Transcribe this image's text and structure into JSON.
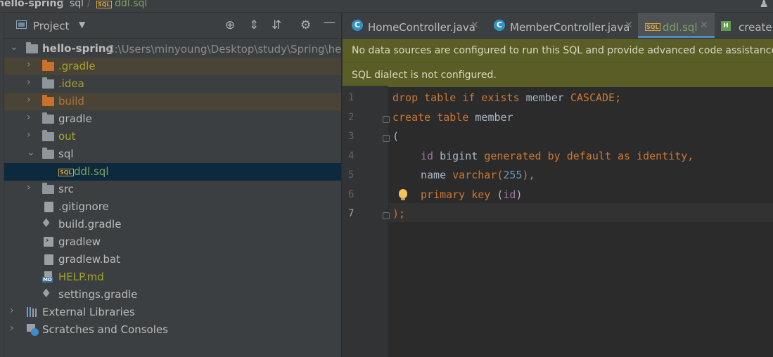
{
  "breadcrumb": {
    "items": [
      "hello-spring",
      "sql",
      "ddl.sql"
    ],
    "file_badge": "SQL"
  },
  "project_panel": {
    "title": "Project",
    "toolbar_icons": [
      "locate-icon",
      "expand-all-icon",
      "collapse-all-icon",
      "gear-icon",
      "minimize-icon"
    ],
    "root": {
      "name": "hello-spring",
      "path": "C:\\Users\\minyoung\\Desktop\\study\\Spring\\he"
    },
    "tree": [
      {
        "label": ".gradle",
        "type": "folder"
      },
      {
        "label": ".idea",
        "type": "folder"
      },
      {
        "label": "build",
        "type": "folder"
      },
      {
        "label": "gradle",
        "type": "folder"
      },
      {
        "label": "out",
        "type": "folder"
      },
      {
        "label": "sql",
        "type": "folder"
      },
      {
        "label": "ddl.sql",
        "type": "sql-file"
      },
      {
        "label": "src",
        "type": "folder"
      },
      {
        "label": ".gitignore",
        "type": "file"
      },
      {
        "label": "build.gradle",
        "type": "gradle-file"
      },
      {
        "label": "gradlew",
        "type": "script-file"
      },
      {
        "label": "gradlew.bat",
        "type": "file"
      },
      {
        "label": "HELP.md",
        "type": "md-file"
      },
      {
        "label": "settings.gradle",
        "type": "gradle-file"
      },
      {
        "label": "External Libraries",
        "type": "libraries"
      },
      {
        "label": "Scratches and Consoles",
        "type": "scratches"
      }
    ],
    "md_badge": "MD"
  },
  "editor": {
    "tabs": [
      {
        "label": "HomeController.java",
        "icon": "C"
      },
      {
        "label": "MemberController.java",
        "icon": "C"
      },
      {
        "label": "ddl.sql",
        "icon": "SQL"
      },
      {
        "label": "createM",
        "icon": "H"
      }
    ],
    "banners": [
      "No data sources are configured to run this SQL and provide advanced code assistance.",
      "SQL dialect is not configured."
    ],
    "line_numbers": [
      "1",
      "2",
      "3",
      "4",
      "5",
      "6",
      "7"
    ],
    "code": {
      "l1_kw": "drop table if exists",
      "l1_plain": " member ",
      "l1_kw2": "CASCADE;",
      "l2_kw": "create table",
      "l2_plain": " member",
      "l3": "(",
      "l4_col": "id",
      "l4_type": " bigint ",
      "l4_kw": "generated by default as identity,",
      "l5_plain": "name ",
      "l5_kw": "varchar(",
      "l5_num": "255",
      "l5_end": "),",
      "l6_kw": "primary key",
      "l6_open": " (",
      "l6_col": "id",
      "l6_close": ")",
      "l7": ");"
    }
  },
  "colors": {
    "keyword": "#cc7832",
    "number": "#6897bb",
    "identifier": "#9876aa",
    "banner": "#5a5e26",
    "selection": "#0d293e"
  }
}
